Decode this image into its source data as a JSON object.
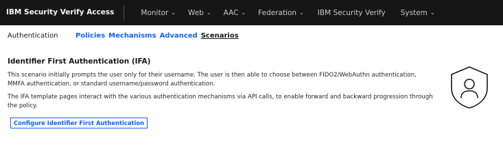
{
  "header": {
    "brand": "IBM Security Verify Access",
    "nav": [
      {
        "label": "Monitor",
        "has_dropdown": true
      },
      {
        "label": "Web",
        "has_dropdown": true
      },
      {
        "label": "AAC",
        "has_dropdown": true
      },
      {
        "label": "Federation",
        "has_dropdown": true
      },
      {
        "label": "IBM Security Verify",
        "has_dropdown": false
      },
      {
        "label": "System",
        "has_dropdown": true
      }
    ],
    "colors": {
      "background": "#161616",
      "text": "#c6c6c6",
      "brand_text": "#f4f4f4"
    }
  },
  "subnav": {
    "title": "Authentication",
    "tabs": [
      {
        "label": "Policies",
        "active": false
      },
      {
        "label": "Mechanisms",
        "active": false
      },
      {
        "label": "Advanced",
        "active": false
      },
      {
        "label": "Scenarios",
        "active": true
      }
    ]
  },
  "main": {
    "heading": "Identifier First Authentication (IFA)",
    "paragraphs": [
      "This scenario initially prompts the user only for their username. The user is then able to choose between FIDO2/WebAuthn authentication, MMFA authentication, or standard username/password authentication.",
      "The IFA template pages interact with the various authentication mechanisms via API calls, to enable forward and backward progression through the policy."
    ],
    "configure_button": "Configure Identifier First Authentication",
    "illustration_icon": "shield-user-icon"
  },
  "colors": {
    "accent": "#0f62fe",
    "text": "#161616"
  }
}
